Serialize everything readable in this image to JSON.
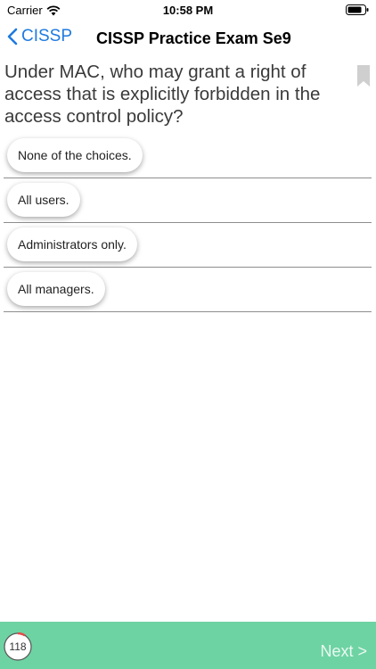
{
  "status_bar": {
    "carrier": "Carrier",
    "time": "10:58 PM",
    "wifi_icon": "wifi-icon",
    "battery_icon": "battery-icon"
  },
  "nav": {
    "back_label": "CISSP",
    "title": "CISSP Practice Exam Se9",
    "accent_color": "#1f7ae0"
  },
  "question": {
    "text": "Under MAC, who may grant a right of access that is explicitly forbidden in the access control policy?",
    "bookmark_icon": "bookmark-icon"
  },
  "answers": [
    {
      "label": "None of the choices."
    },
    {
      "label": "All users."
    },
    {
      "label": "Administrators only."
    },
    {
      "label": "All managers."
    }
  ],
  "footer": {
    "progress_count": "118",
    "next_label": "Next >",
    "bar_color": "#6ed3a3",
    "progress_ring_color": "#e64a4a"
  }
}
